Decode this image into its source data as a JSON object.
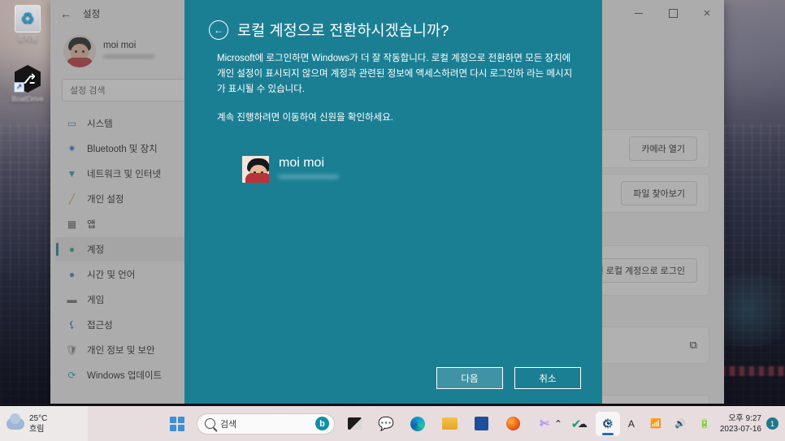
{
  "desktop": {
    "icons": [
      {
        "name": "recycle-bin",
        "label": "휴지통",
        "glyph": "♻"
      },
      {
        "name": "boatdrive",
        "label": "BoatDrive",
        "glyph": "Ⓑ"
      }
    ],
    "weather": {
      "temperature": "25°C",
      "condition": "흐림",
      "icon": "cloud-icon"
    }
  },
  "taskbar": {
    "start_label": "시작",
    "search": {
      "value": "검색",
      "placeholder": "검색",
      "icon": "search-icon",
      "assistant_icon": "bing-chat-icon"
    },
    "apps": [
      {
        "name": "task-view",
        "glyph": "▣"
      },
      {
        "name": "chat-teams",
        "glyph": "💬"
      },
      {
        "name": "microsoft-edge",
        "glyph": "🌐"
      },
      {
        "name": "file-explorer",
        "glyph": "📁"
      },
      {
        "name": "microsoft-store",
        "glyph": "🛍"
      },
      {
        "name": "firefox",
        "glyph": "🦊"
      },
      {
        "name": "snipping-tool",
        "glyph": "✂"
      },
      {
        "name": "hancom-app",
        "glyph": "✔"
      },
      {
        "name": "settings",
        "glyph": "⚙"
      }
    ],
    "tray": [
      {
        "name": "show-hidden-icons",
        "glyph": "⌃"
      },
      {
        "name": "onedrive",
        "glyph": "☁"
      },
      {
        "name": "update-pending",
        "glyph": "⟳"
      },
      {
        "name": "ime-input-mode",
        "glyph": "A"
      },
      {
        "name": "wifi",
        "glyph": "📶"
      },
      {
        "name": "volume",
        "glyph": "🔊"
      },
      {
        "name": "battery",
        "glyph": "🔋"
      }
    ],
    "clock": {
      "time": "오후 9:27",
      "date": "2023-07-16"
    },
    "notification_count": "1"
  },
  "settings_window": {
    "title": "설정",
    "back_icon": "back-arrow-icon",
    "controls": {
      "minimize": "minimize-icon",
      "maximize": "maximize-icon",
      "close": "close-icon"
    },
    "profile": {
      "name": "moi moi",
      "email": "••••••••••••••••••"
    },
    "search_placeholder": "설정 검색",
    "nav": [
      {
        "name": "system",
        "label": "시스템",
        "glyph": "🖥",
        "color": "#3f7fd0",
        "selected": false
      },
      {
        "name": "bluetooth-devices",
        "label": "Bluetooth 및 장치",
        "glyph": "✦",
        "color": "#1e78d7",
        "selected": false
      },
      {
        "name": "network-internet",
        "label": "네트워크 및 인터넷",
        "glyph": "◥",
        "color": "#1e9bb5",
        "selected": false
      },
      {
        "name": "personalization",
        "label": "개인 설정",
        "glyph": "🖌",
        "color": "#d98b2b",
        "selected": false
      },
      {
        "name": "apps",
        "label": "앱",
        "glyph": "▤",
        "color": "#5a5a5a",
        "selected": false
      },
      {
        "name": "accounts",
        "label": "계정",
        "glyph": "👤",
        "color": "#2aa17a",
        "selected": true
      },
      {
        "name": "time-language",
        "label": "시간 및 언어",
        "glyph": "🕘",
        "color": "#3f7fd0",
        "selected": false
      },
      {
        "name": "gaming",
        "label": "게임",
        "glyph": "🎮",
        "color": "#6a6a6a",
        "selected": false
      },
      {
        "name": "accessibility",
        "label": "접근성",
        "glyph": "🧍",
        "color": "#1e78d7",
        "selected": false
      },
      {
        "name": "privacy-security",
        "label": "개인 정보 및 보안",
        "glyph": "🛡",
        "color": "#7a7a7a",
        "selected": false
      },
      {
        "name": "windows-update",
        "label": "Windows 업데이트",
        "glyph": "⟳",
        "color": "#1e9bb5",
        "selected": false
      }
    ],
    "content_cards": [
      {
        "name": "open-camera",
        "button": "카메라 열기",
        "kind": "button"
      },
      {
        "name": "browse-files",
        "button": "파일 찾아보기",
        "kind": "button"
      },
      {
        "name": "sign-in-local-account",
        "button": "대신 로컬 계정으로 로그인",
        "kind": "button"
      },
      {
        "name": "external-link-card",
        "button": "",
        "kind": "external",
        "glyph": "⧉"
      },
      {
        "name": "expander-card",
        "button": "",
        "kind": "chevron",
        "glyph": "⌃"
      }
    ]
  },
  "modal": {
    "back_icon": "back-arrow-circle-icon",
    "title": "로컬 계정으로 전환하시겠습니까?",
    "paragraph1": "Microsoft에 로그인하면 Windows가 더 잘 작동합니다. 로컬 계정으로 전환하면 모든 장치에 개인 설정이 표시되지 않으며 계정과 관련된 정보에 액세스하려면 다시 로그인하 라는 메시지가 표시될 수 있습니다.",
    "paragraph2": "계속 진행하려면 이동하여 신원을 확인하세요.",
    "user": {
      "name": "moi moi",
      "email": "••••••••••••••••••••"
    },
    "buttons": {
      "next": "다음",
      "cancel": "취소"
    },
    "accent_color": "#1b7f94"
  }
}
